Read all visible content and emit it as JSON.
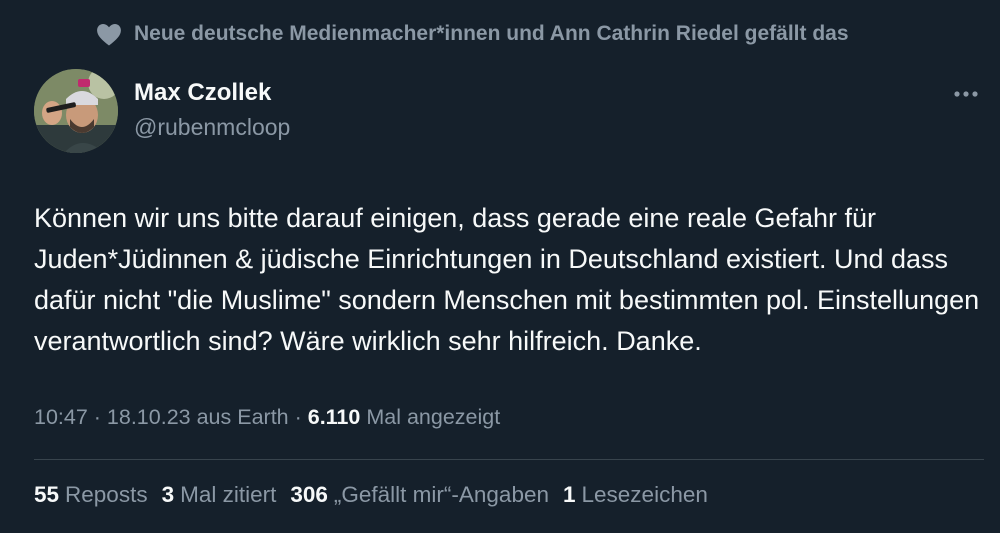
{
  "social_context": {
    "icon": "heart-icon",
    "text": "Neue deutsche Medienmacher*innen und Ann Cathrin Riedel gefällt das"
  },
  "author": {
    "display_name": "Max Czollek",
    "handle": "@rubenmcloop"
  },
  "tweet": {
    "text": "Können wir uns bitte darauf einigen, dass gerade eine reale Gefahr für Juden*Jüdinnen & jüdische Einrichtungen in Deutschland existiert. Und dass dafür nicht \"die Muslime\" sondern Menschen mit bestimmten pol. Einstellungen verantwortlich sind? Wäre wirklich sehr hilfreich. Danke."
  },
  "meta": {
    "time": "10:47",
    "separator1": " · ",
    "date": "18.10.23",
    "source": " aus Earth",
    "separator2": " · ",
    "views_count": "6.110",
    "views_label": " Mal angezeigt"
  },
  "stats": [
    {
      "count": "55",
      "label": "Reposts"
    },
    {
      "count": "3",
      "label": "Mal zitiert"
    },
    {
      "count": "306",
      "label": "„Gefällt mir“-Angaben"
    },
    {
      "count": "1",
      "label": "Lesezeichen"
    }
  ],
  "colors": {
    "background": "#15202b",
    "primary_text": "#f7f9f9",
    "secondary_text": "#8b98a5",
    "divider": "#38444d"
  }
}
